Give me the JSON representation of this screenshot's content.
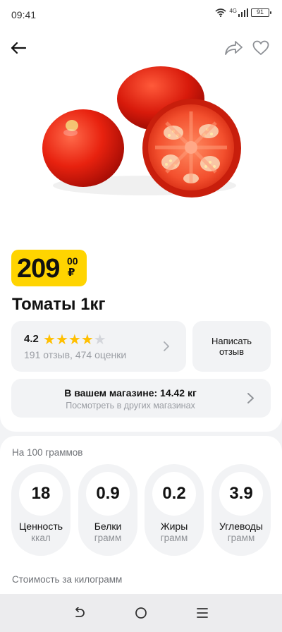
{
  "status_bar": {
    "time": "09:41",
    "network": "4G",
    "battery": "91"
  },
  "header": {
    "back_icon": "arrow-left-icon",
    "share_icon": "share-icon",
    "favorite_icon": "heart-icon"
  },
  "product": {
    "image_icon": "tomatoes-image",
    "price_main": "209",
    "price_cents": "00",
    "currency": "₽",
    "title": "Томаты 1кг"
  },
  "rating": {
    "value": "4.2",
    "stars": 4,
    "max_stars": 5,
    "summary": "191 отзыв, 474 оценки"
  },
  "review_button": {
    "label": "Написать отзыв"
  },
  "store": {
    "availability": "В вашем магазине: 14.42 кг",
    "link": "Посмотреть в других магазинах"
  },
  "nutrition": {
    "header": "На 100 граммов",
    "items": [
      {
        "value": "18",
        "name": "Ценность",
        "unit": "ккал"
      },
      {
        "value": "0.9",
        "name": "Белки",
        "unit": "грамм"
      },
      {
        "value": "0.2",
        "name": "Жиры",
        "unit": "грамм"
      },
      {
        "value": "3.9",
        "name": "Углеводы",
        "unit": "грамм"
      }
    ]
  },
  "cost_section": {
    "header": "Стоимость за килограмм"
  },
  "colors": {
    "accent_yellow": "#ffd400",
    "star": "#ffbf00",
    "card_bg": "#f2f3f5"
  }
}
